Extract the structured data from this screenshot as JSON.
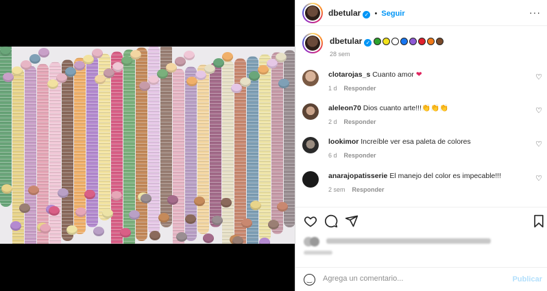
{
  "post": {
    "username": "dbetular",
    "follow_label": "Seguir",
    "more_icon": "more-horizontal-icon",
    "caption_time": "28 sem",
    "caption_colors": [
      "#2fa32f",
      "#f2e21a",
      "#ffffff",
      "#1877f2",
      "#8e5ad6",
      "#e0212e",
      "#f07a1a",
      "#7a4a2a"
    ]
  },
  "comments": [
    {
      "user": "clotarojas_s",
      "text": "Cuanto amor",
      "emoji": "❤",
      "time": "1 d",
      "reply": "Responder"
    },
    {
      "user": "aleleon70",
      "text": "Dios cuanto arte!!!",
      "emoji": "👏👏👏",
      "time": "2 d",
      "reply": "Responder"
    },
    {
      "user": "lookimor",
      "text": "Increíble ver esa paleta de colores",
      "emoji": "",
      "time": "6 d",
      "reply": "Responder"
    },
    {
      "user": "anarajopatisserie",
      "text": "El manejo del color es impecable!!!",
      "emoji": "",
      "time": "2 sem",
      "reply": "Responder"
    }
  ],
  "actions": {
    "icons": [
      "heart-icon",
      "comment-icon",
      "share-icon",
      "save-icon"
    ]
  },
  "add_comment": {
    "placeholder": "Agrega un comentario...",
    "publish_label": "Publicar"
  },
  "colors": {
    "accent": "#0095f6",
    "text": "#262626",
    "muted": "#8e8e8e"
  }
}
